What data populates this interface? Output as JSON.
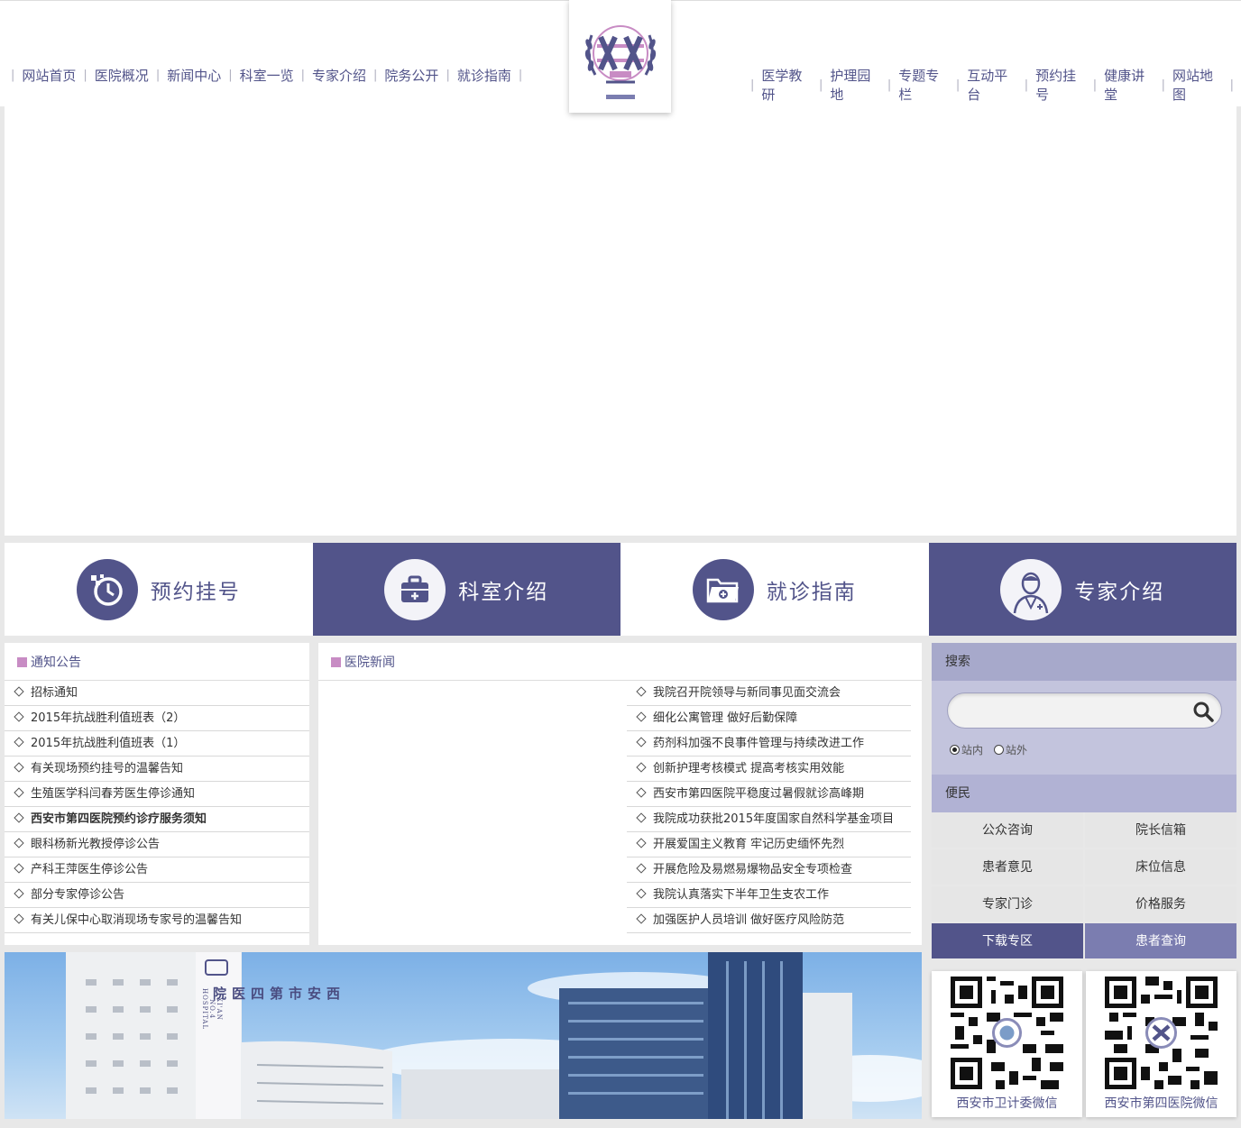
{
  "nav_left": [
    "网站首页",
    "医院概况",
    "新闻中心",
    "科室一览",
    "专家介绍",
    "院务公开",
    "就诊指南"
  ],
  "nav_right": [
    "医学教研",
    "护理园地",
    "专题专栏",
    "互动平台",
    "预约挂号",
    "健康讲堂",
    "网站地图"
  ],
  "tiles": [
    {
      "label": "预约挂号",
      "icon": "clock-refresh-icon"
    },
    {
      "label": "科室介绍",
      "icon": "medical-kit-icon"
    },
    {
      "label": "就诊指南",
      "icon": "folder-plus-icon"
    },
    {
      "label": "专家介绍",
      "icon": "doctor-icon"
    }
  ],
  "notice": {
    "title": "通知公告",
    "items": [
      "招标通知",
      "2015年抗战胜利值班表（2）",
      "2015年抗战胜利值班表（1）",
      "有关现场预约挂号的温馨告知",
      "生殖医学科闫春芳医生停诊通知",
      "西安市第四医院预约诊疗服务须知",
      "眼科杨新光教授停诊公告",
      "产科王萍医生停诊公告",
      "部分专家停诊公告",
      "有关儿保中心取消现场专家号的温馨告知"
    ]
  },
  "news": {
    "title": "医院新闻",
    "items": [
      "我院召开院领导与新同事见面交流会",
      "细化公寓管理 做好后勤保障",
      "药剂科加强不良事件管理与持续改进工作",
      "创新护理考核模式 提高考核实用效能",
      "西安市第四医院平稳度过暑假就诊高峰期",
      "我院成功获批2015年度国家自然科学基金项目",
      "开展爱国主义教育 牢记历史缅怀先烈",
      "开展危险及易燃易爆物品安全专项检查",
      "我院认真落实下半年卫生支农工作",
      "加强医护人员培训 做好医疗风险防范"
    ]
  },
  "search": {
    "title": "搜索",
    "placeholder": "",
    "opt_in": "站内",
    "opt_out": "站外"
  },
  "bianmin": {
    "title": "便民",
    "items": [
      "公众咨询",
      "院长信箱",
      "患者意见",
      "床位信息",
      "专家门诊",
      "价格服务",
      "下载专区",
      "患者查询"
    ]
  },
  "qr": [
    "西安市卫计委微信",
    "西安市第四医院微信"
  ],
  "photo": {
    "sign_cn": "西安市第四医院",
    "sign_en": "XI'AN NO.4 HOSPITAL"
  },
  "colors": {
    "primary": "#52548a",
    "accent": "#c88cc4",
    "side_head": "#a7a9cb"
  }
}
